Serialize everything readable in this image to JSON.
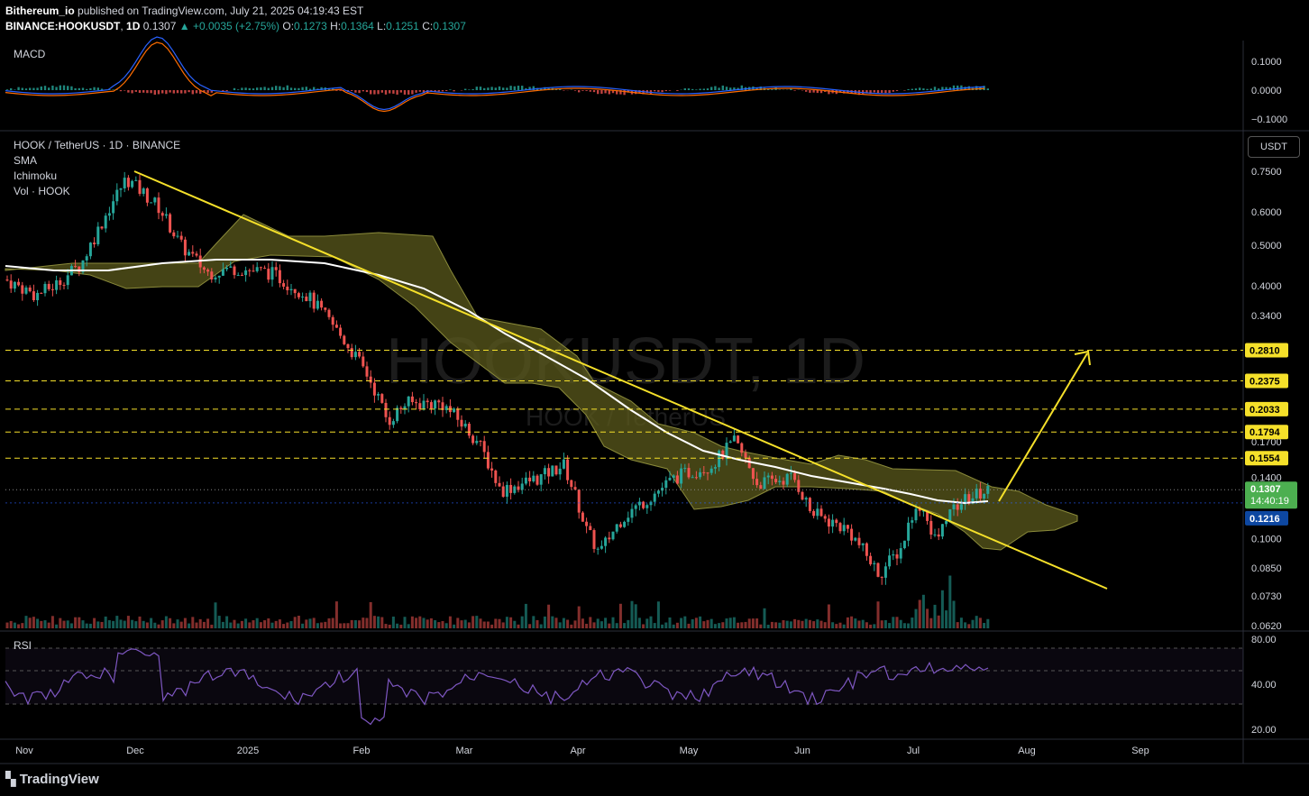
{
  "header": {
    "author": "Bithereum_io",
    "published": "published on TradingView.com, July 21, 2025 04:19:43 EST",
    "symbol": "BINANCE:HOOKUSDT",
    "interval": "1D",
    "last": "0.1307",
    "change": "▲ +0.0035 (+2.75%)",
    "o_label": "O:",
    "o": "0.1273",
    "h_label": "H:",
    "h": "0.1364",
    "l_label": "L:",
    "l": "0.1251",
    "c_label": "C:",
    "c": "0.1307"
  },
  "panes": {
    "macd_label": "MACD",
    "main_title": "HOOK / TetherUS · 1D · BINANCE",
    "indicators": [
      "SMA",
      "Ichimoku",
      "Vol · HOOK"
    ],
    "rsi_label": "RSI",
    "unit_button": "USDT"
  },
  "watermark": {
    "main": "HOOKUSDT, 1D",
    "sub": "HOOK / TetherUS"
  },
  "price_axis": [
    "0.7500",
    "0.6000",
    "0.5000",
    "0.4000",
    "0.3400",
    "0.1700",
    "0.1400",
    "0.1000",
    "0.0850",
    "0.0730",
    "0.0620"
  ],
  "macd_axis": [
    "0.1000",
    "0.0000",
    "−0.1000"
  ],
  "rsi_axis": [
    "80.00",
    "40.00",
    "20.00"
  ],
  "time_axis": [
    "Nov",
    "Dec",
    "2025",
    "Feb",
    "Mar",
    "Apr",
    "May",
    "Jun",
    "Jul",
    "Aug",
    "Sep"
  ],
  "levels": [
    {
      "value": 0.281,
      "label": "0.2810"
    },
    {
      "value": 0.2375,
      "label": "0.2375"
    },
    {
      "value": 0.2033,
      "label": "0.2033"
    },
    {
      "value": 0.1794,
      "label": "0.1794"
    },
    {
      "value": 0.1554,
      "label": "0.1554"
    }
  ],
  "price_tag": {
    "value": 0.1307,
    "label": "0.1307",
    "countdown": "14:40:19"
  },
  "sma_tag": {
    "value": 0.1216,
    "label": "0.1216"
  },
  "colors": {
    "up": "#26a69a",
    "down": "#ef5350",
    "level": "#f5e02a",
    "trend": "#f5e02a",
    "cloud": "#5b5a1c",
    "sma": "#ffffff",
    "macd": "#2962ff",
    "signal": "#ff6d00",
    "rsi": "#7e57c2",
    "last_tag": "#4caf50",
    "sma_tag": "#0d47a1"
  },
  "brand": "TradingView"
}
